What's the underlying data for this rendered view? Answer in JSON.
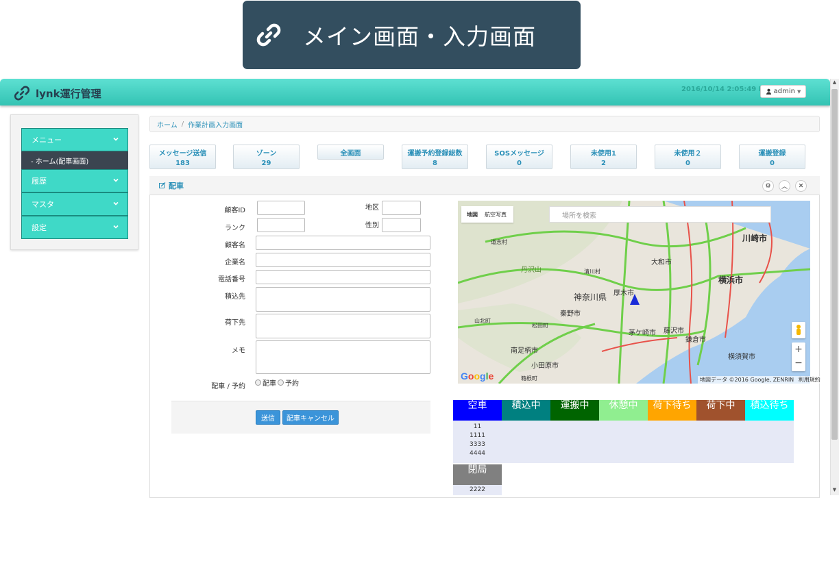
{
  "slide": {
    "title": "メイン画面・入力画面"
  },
  "app": {
    "brand": "lynk運行管理",
    "datetime": "2016/10/14 2:05:49 PM",
    "user": "admin"
  },
  "sidebar": {
    "items": [
      {
        "label": "メニュー"
      },
      {
        "label": "履歴"
      },
      {
        "label": "マスタ"
      },
      {
        "label": "設定"
      }
    ],
    "sub_item": "- ホーム(配車画面)"
  },
  "breadcrumb": {
    "home": "ホーム",
    "sep": "/",
    "current": "作業計画入力画面"
  },
  "stats": [
    {
      "label": "メッセージ送信",
      "value": "183"
    },
    {
      "label": "ゾーン",
      "value": "29"
    },
    {
      "label": "全画面",
      "value": ""
    },
    {
      "label": "運搬予約登録総数",
      "value": "8"
    },
    {
      "label": "SOSメッセージ",
      "value": "0"
    },
    {
      "label": "未使用1",
      "value": "2"
    },
    {
      "label": "未使用２",
      "value": "0"
    },
    {
      "label": "運搬登録",
      "value": "0"
    }
  ],
  "panel": {
    "title": "配車"
  },
  "form": {
    "customer_id": "顧客ID",
    "area": "地区",
    "rank": "ランク",
    "gender": "性別",
    "customer_name": "顧客名",
    "company_name": "企業名",
    "phone": "電話番号",
    "load_from": "積込先",
    "unload_to": "荷下先",
    "memo": "メモ",
    "dispatch_label": "配車 / 予約",
    "opt_dispatch": "配車",
    "opt_reserve": "予約",
    "submit": "送信",
    "cancel": "配車キャンセル"
  },
  "map": {
    "tab_map": "地図",
    "tab_aerial": "航空写真",
    "search_placeholder": "場所を検索",
    "credit": "地図データ ©2016 Google, ZENRIN",
    "terms": "利用規約",
    "places": [
      "川崎市",
      "大和市",
      "横浜市",
      "神奈川県",
      "厚木市",
      "丹沢山",
      "清川村",
      "秦野市",
      "茅ケ崎市",
      "藤沢市",
      "鎌倉市",
      "横須賀市",
      "南足柄市",
      "小田原市",
      "松田町",
      "箱根町",
      "山北町",
      "道志村"
    ]
  },
  "status_table": {
    "headers": [
      {
        "label": "空車",
        "color": "#0000ff"
      },
      {
        "label": "積込中",
        "color": "#008080"
      },
      {
        "label": "運搬中",
        "color": "#006400"
      },
      {
        "label": "休憩中",
        "color": "#90ee90"
      },
      {
        "label": "荷下待ち",
        "color": "#ffa500"
      },
      {
        "label": "荷下中",
        "color": "#a0522d"
      },
      {
        "label": "積込待ち",
        "color": "#00ffff"
      },
      {
        "label": "閉局",
        "color": "#808080"
      }
    ],
    "empty_ids": [
      "11",
      "1111",
      "3333",
      "4444"
    ],
    "closed_ids": [
      "2222"
    ]
  }
}
